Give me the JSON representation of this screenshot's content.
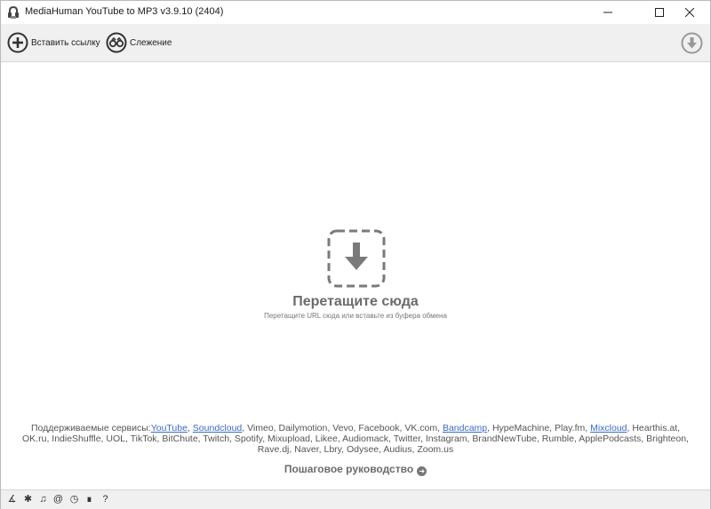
{
  "window": {
    "title": "MediaHuman YouTube to MP3 v3.9.10 (2404)"
  },
  "toolbar": {
    "paste_label": "Вставить ссылку",
    "track_label": "Слежение"
  },
  "drop": {
    "title": "Перетащите сюда",
    "subtitle": "Перетащите URL сюда или вставьте из буфера обмена"
  },
  "services": {
    "prefix": "Поддерживаемые сервисы:",
    "youtube": "YouTube",
    "soundcloud": "Soundcloud",
    "seg1": ", Vimeo, Dailymotion, Vevo, Facebook, VK.com, ",
    "bandcamp": "Bandcamp",
    "seg2": ", HypeMachine, Play.fm, ",
    "mixcloud": "Mixcloud",
    "seg3": ", Hearthis.at, OK.ru, IndieShuffle, UOL, TikTok, BitChute, Twitch, Spotify, Mixupload, Likee, Audiomack, Twitter, Instagram, BrandNewTube, Rumble, ApplePodcasts, Brighteon, Rave.dj, Naver, Lbry, Odysee, Audius, Zoom.us",
    "comma": ", "
  },
  "guide": {
    "label": "Пошаговое руководство"
  },
  "colors": {
    "toolbar_bg": "#f0f0f0",
    "link": "#3a6bc9",
    "muted_text": "#6b6b6b"
  },
  "statusbar_icons": [
    "broom-icon",
    "gear-icon",
    "music-note-icon",
    "snail-icon",
    "clock-icon",
    "binoculars-icon",
    "help-icon"
  ]
}
